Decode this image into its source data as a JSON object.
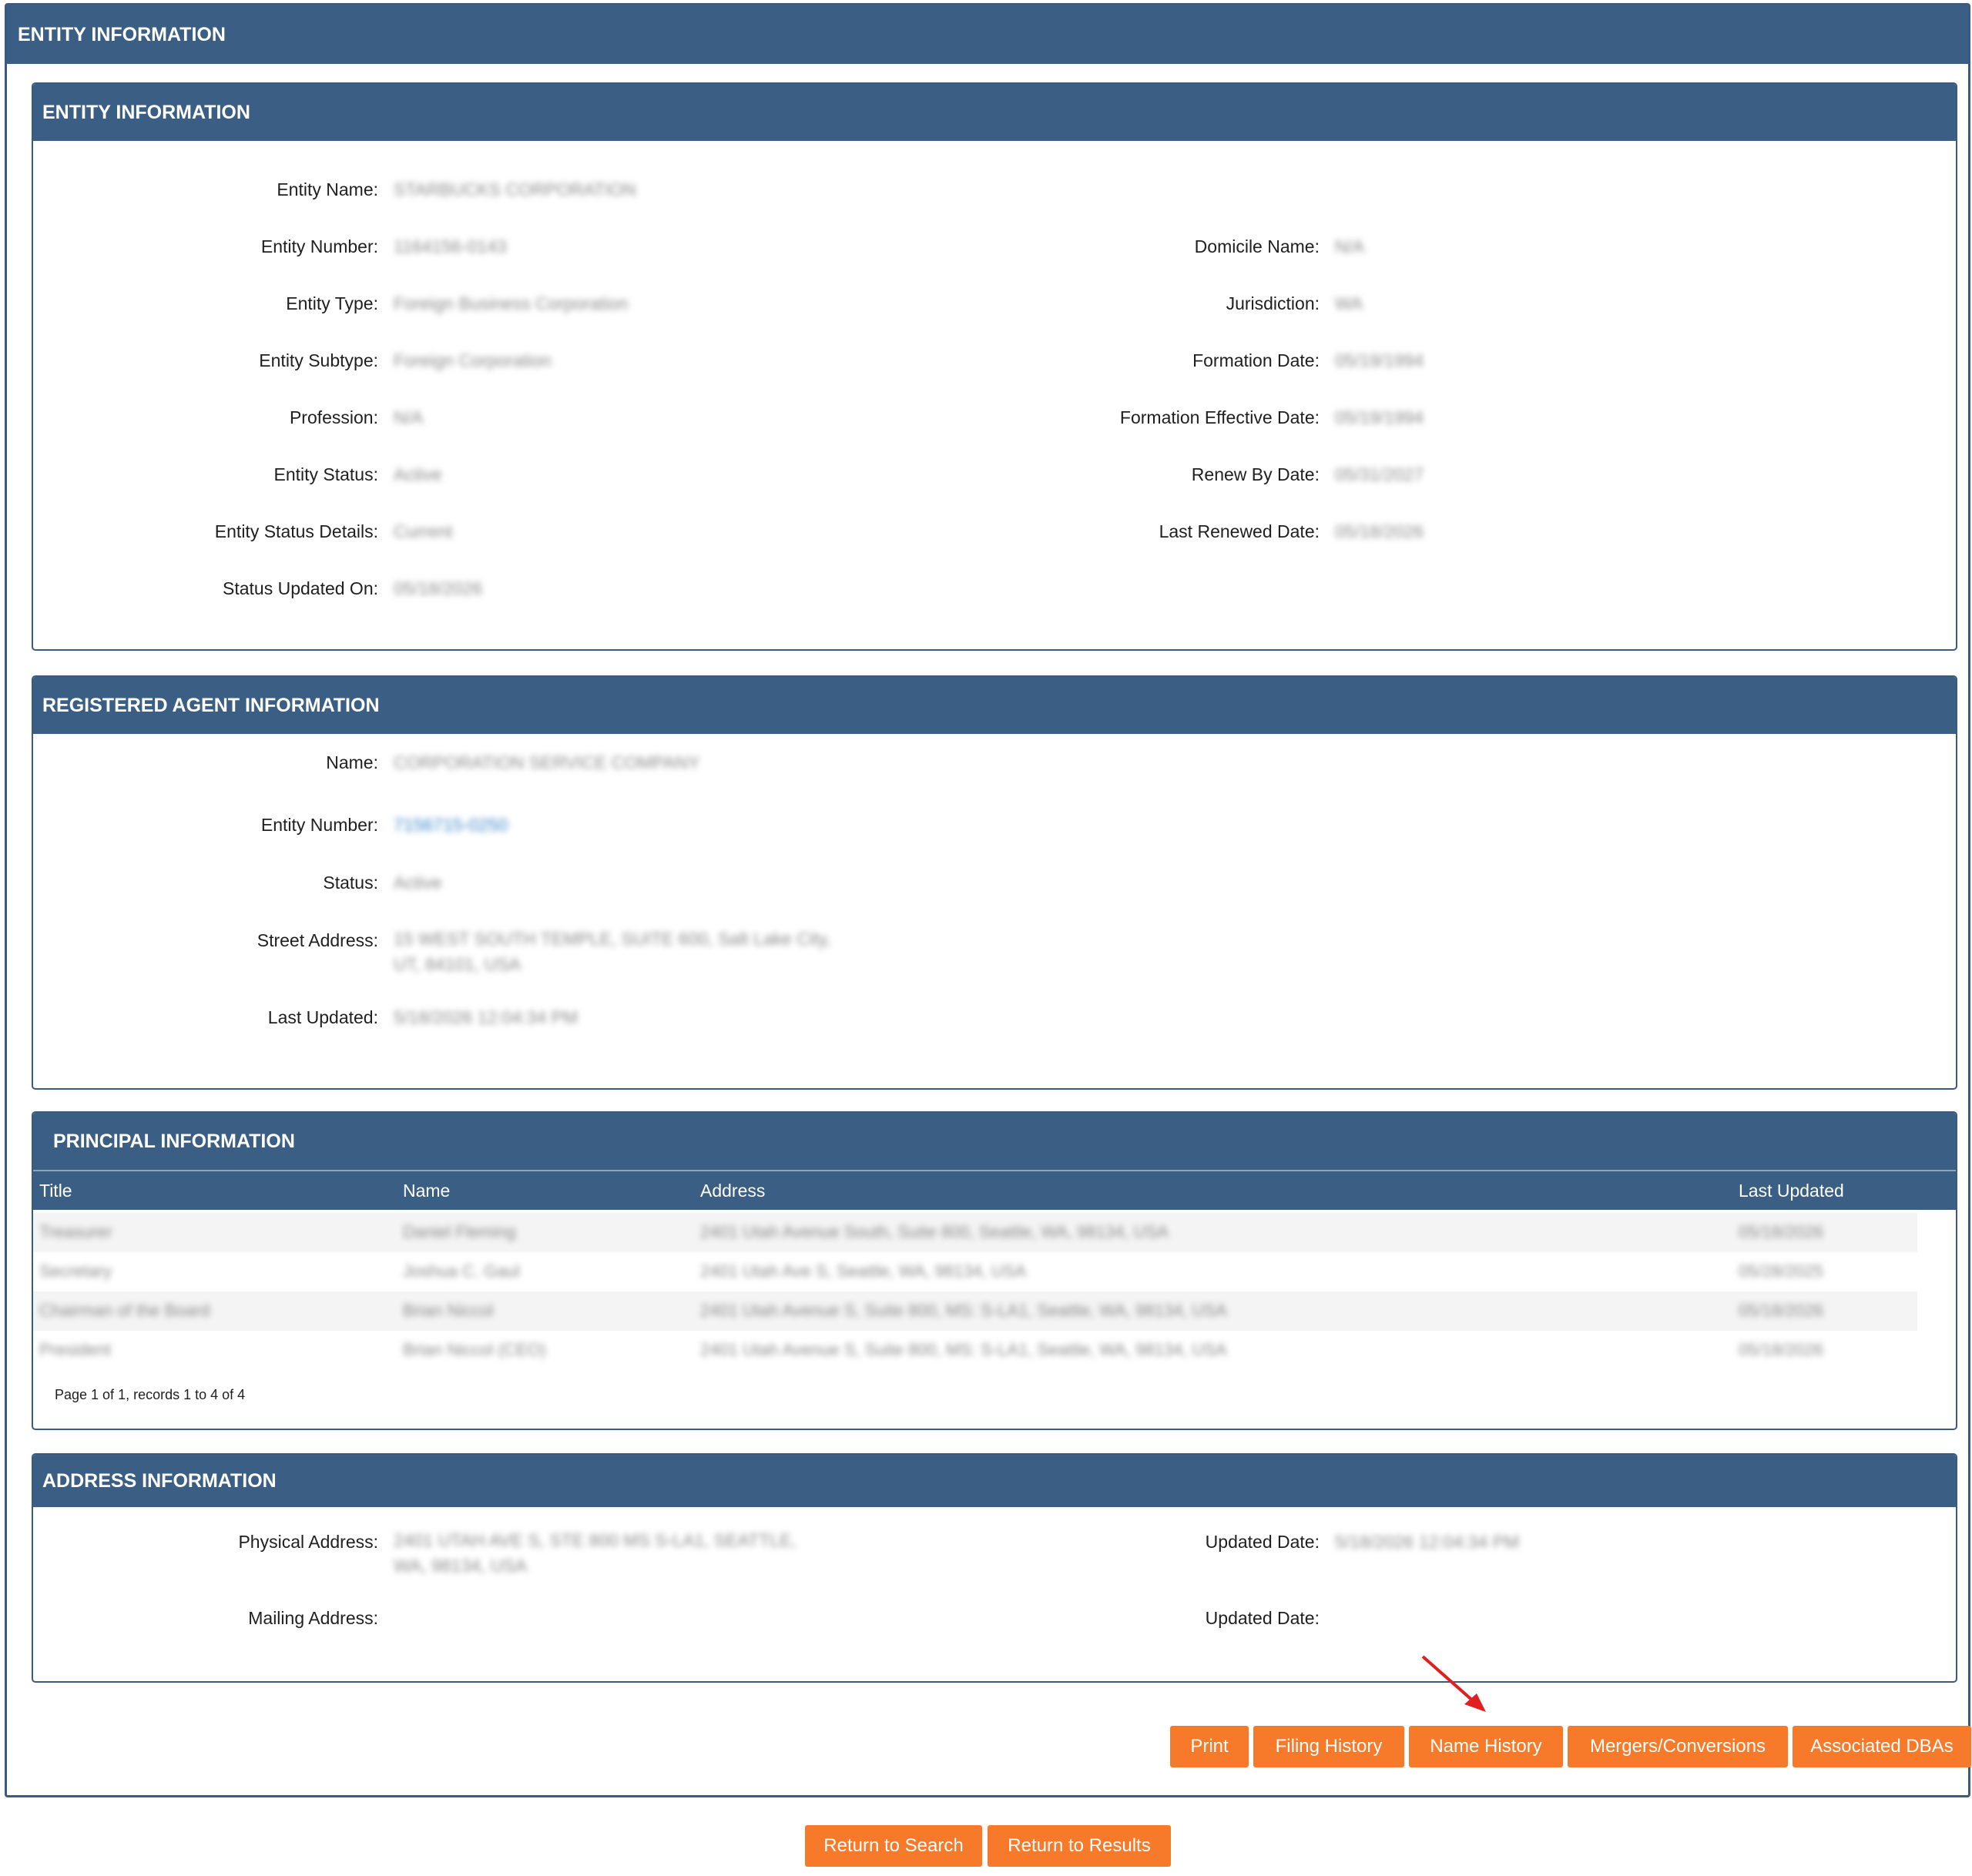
{
  "header": {
    "title": "ENTITY INFORMATION"
  },
  "entity_panel": {
    "title": "ENTITY INFORMATION",
    "left": [
      {
        "label": "Entity Name:",
        "value": "STARBUCKS CORPORATION"
      },
      {
        "label": "Entity Number:",
        "value": "1164156-0143"
      },
      {
        "label": "Entity Type:",
        "value": "Foreign Business Corporation"
      },
      {
        "label": "Entity Subtype:",
        "value": "Foreign Corporation"
      },
      {
        "label": "Profession:",
        "value": "N/A"
      },
      {
        "label": "Entity Status:",
        "value": "Active"
      },
      {
        "label": "Entity Status Details:",
        "value": "Current"
      },
      {
        "label": "Status Updated On:",
        "value": "05/18/2026"
      }
    ],
    "right": [
      {
        "label": "Domicile Name:",
        "value": "N/A"
      },
      {
        "label": "Jurisdiction:",
        "value": "WA"
      },
      {
        "label": "Formation Date:",
        "value": "05/19/1994"
      },
      {
        "label": "Formation Effective Date:",
        "value": "05/19/1994"
      },
      {
        "label": "Renew By Date:",
        "value": "05/31/2027"
      },
      {
        "label": "Last Renewed Date:",
        "value": "05/18/2026"
      }
    ]
  },
  "agent_panel": {
    "title": "REGISTERED AGENT INFORMATION",
    "name_label": "Name:",
    "name_value": "CORPORATION SERVICE COMPANY",
    "number_label": "Entity Number:",
    "number_value": "7156715-0250",
    "status_label": "Status:",
    "status_value": "Active",
    "street_label": "Street Address:",
    "street_value": "15 WEST SOUTH TEMPLE, SUITE 600, Salt Lake City, UT, 84101, USA",
    "updated_label": "Last Updated:",
    "updated_value": "5/18/2026 12:04:34 PM"
  },
  "principal_panel": {
    "title": "PRINCIPAL INFORMATION",
    "columns": [
      "Title",
      "Name",
      "Address",
      "Last Updated"
    ],
    "rows": [
      {
        "title": "Treasurer",
        "name": "Daniel Fleming",
        "address": "2401 Utah Avenue South, Suite 800, Seattle, WA, 98134, USA",
        "updated": "05/18/2026"
      },
      {
        "title": "Secretary",
        "name": "Joshua C. Gaul",
        "address": "2401 Utah Ave S, Seattle, WA, 98134, USA",
        "updated": "05/28/2025"
      },
      {
        "title": "Chairman of the Board",
        "name": "Brian Niccol",
        "address": "2401 Utah Avenue S, Suite 800, MS: S-LA1, Seattle, WA, 98134, USA",
        "updated": "05/18/2026"
      },
      {
        "title": "President",
        "name": "Brian Niccol (CEO)",
        "address": "2401 Utah Avenue S, Suite 800, MS: S-LA1, Seattle, WA, 98134, USA",
        "updated": "05/18/2026"
      }
    ],
    "pager": "Page 1 of 1, records 1 to 4 of 4"
  },
  "address_panel": {
    "title": "ADDRESS INFORMATION",
    "physical_label": "Physical Address:",
    "physical_value": "2401 UTAH AVE S, STE 800 MS S-LA1, SEATTLE, WA, 98134, USA",
    "phys_updated_label": "Updated Date:",
    "phys_updated_value": "5/18/2026 12:04:34 PM",
    "mailing_label": "Mailing Address:",
    "mailing_value": "",
    "mail_updated_label": "Updated Date:",
    "mail_updated_value": ""
  },
  "actions": {
    "print": "Print",
    "filing_history": "Filing History",
    "name_history": "Name History",
    "mergers": "Mergers/Conversions",
    "dbas": "Associated DBAs"
  },
  "nav": {
    "return_search": "Return to Search",
    "return_results": "Return to Results"
  },
  "colors": {
    "header": "#3b5f84",
    "button": "#f67a2a",
    "annotation_arrow": "#e02020"
  }
}
